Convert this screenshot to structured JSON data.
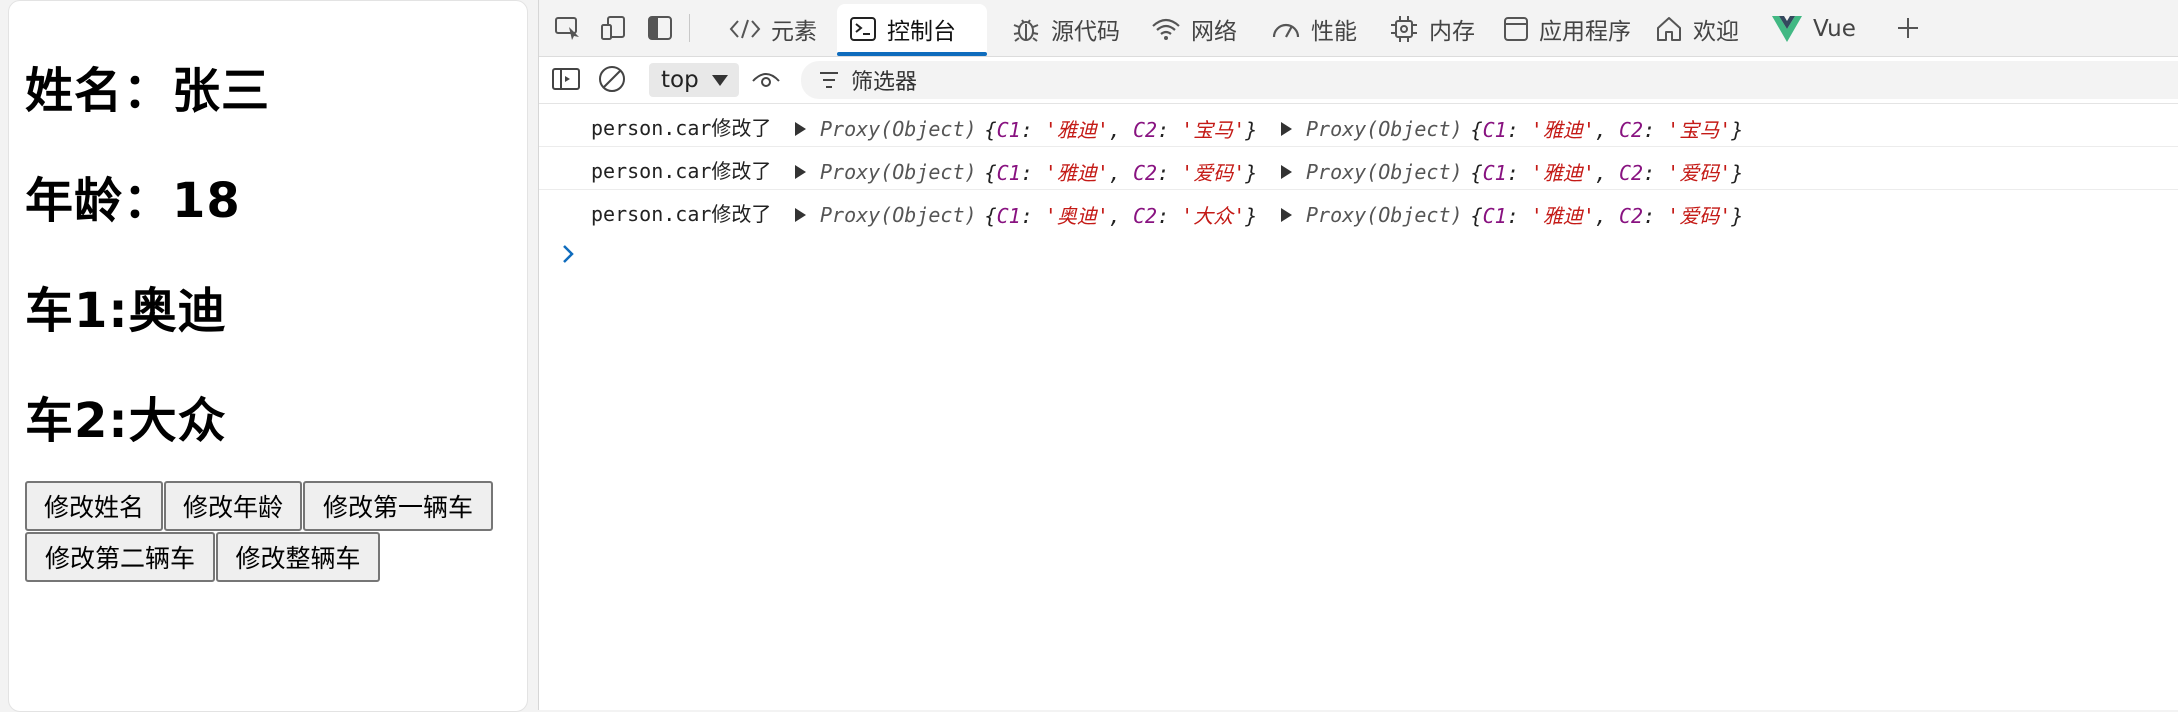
{
  "page": {
    "name_line": "姓名：张三",
    "age_line": "年龄：18",
    "car1_line": "车1:奥迪",
    "car2_line": "车2:大众",
    "buttons": {
      "change_name": "修改姓名",
      "change_age": "修改年龄",
      "change_car1": "修改第一辆车",
      "change_car2": "修改第二辆车",
      "change_all_cars": "修改整辆车"
    }
  },
  "devtools": {
    "tabs": {
      "elements": "元素",
      "console": "控制台",
      "sources": "源代码",
      "network": "网络",
      "performance": "性能",
      "memory": "内存",
      "application": "应用程序",
      "welcome": "欢迎",
      "vue": "Vue"
    },
    "add_tab_icon": "plus-icon",
    "context": "top",
    "filter_placeholder": "筛选器",
    "accent_color": "#0f6cbd",
    "messages": [
      {
        "text": "person.car修改了",
        "proxy_label": "Proxy(Object)",
        "new": {
          "k1": "C1",
          "v1": "'雅迪'",
          "k2": "C2",
          "v2": "'宝马'"
        },
        "old": {
          "k1": "C1",
          "v1": "'雅迪'",
          "k2": "C2",
          "v2": "'宝马'"
        }
      },
      {
        "text": "person.car修改了",
        "proxy_label": "Proxy(Object)",
        "new": {
          "k1": "C1",
          "v1": "'雅迪'",
          "k2": "C2",
          "v2": "'爱码'"
        },
        "old": {
          "k1": "C1",
          "v1": "'雅迪'",
          "k2": "C2",
          "v2": "'爱码'"
        }
      },
      {
        "text": "person.car修改了",
        "proxy_label": "Proxy(Object)",
        "new": {
          "k1": "C1",
          "v1": "'奥迪'",
          "k2": "C2",
          "v2": "'大众'"
        },
        "old": {
          "k1": "C1",
          "v1": "'雅迪'",
          "k2": "C2",
          "v2": "'爱码'"
        }
      }
    ]
  }
}
